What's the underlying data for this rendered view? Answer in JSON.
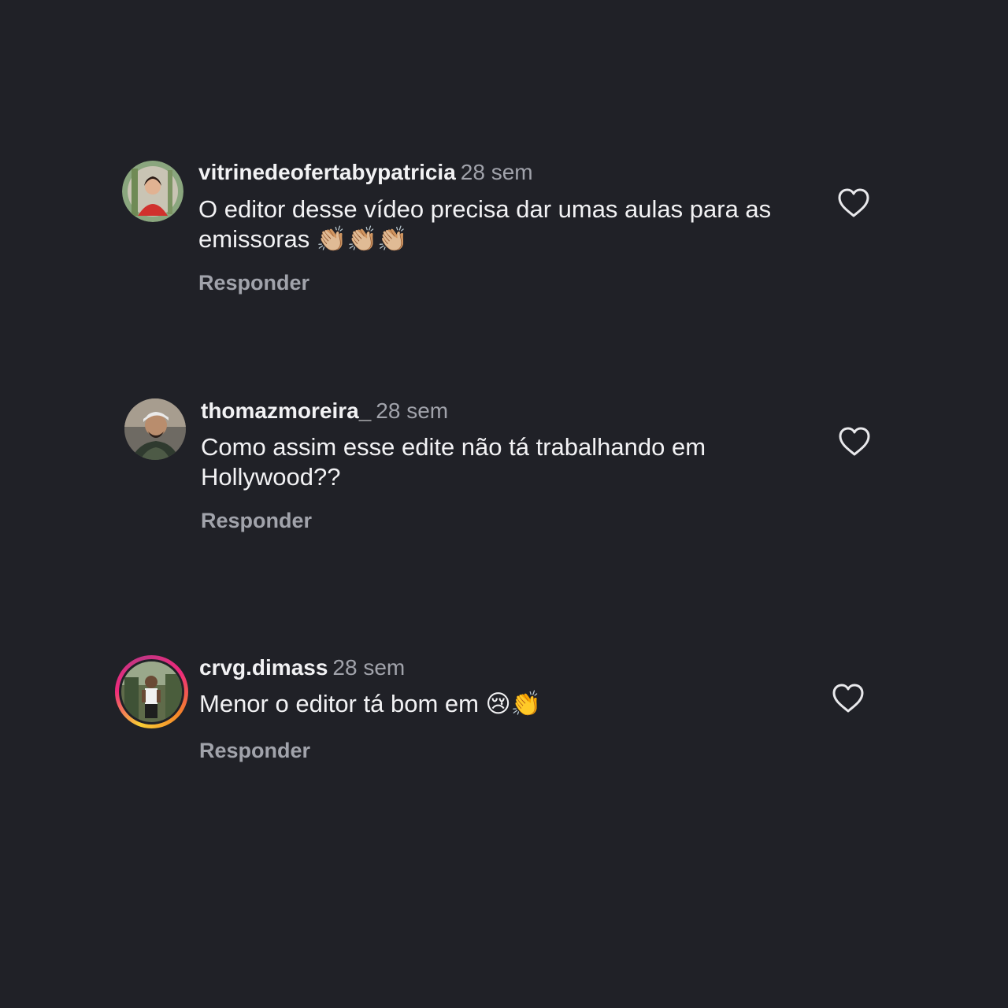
{
  "comments": [
    {
      "username": "vitrinedeofertabypatricia",
      "time": "28 sem",
      "text": "O editor desse vídeo precisa dar umas aulas para as emissoras 👏🏼👏🏼👏🏼",
      "reply_label": "Responder",
      "avatar_icon": "profile-photo-woman-red",
      "has_story_ring": false
    },
    {
      "username": "thomazmoreira_",
      "time": "28 sem",
      "text": "Como assim esse edite não tá trabalhando em Hollywood??",
      "reply_label": "Responder",
      "avatar_icon": "profile-photo-man-cap",
      "has_story_ring": false
    },
    {
      "username": "crvg.dimass",
      "time": "28 sem",
      "text": "Menor o editor tá bom em 😢👏",
      "reply_label": "Responder",
      "avatar_icon": "profile-photo-man-outdoor",
      "has_story_ring": true
    }
  ],
  "like_icon": "heart-outline-icon",
  "colors": {
    "background": "#202127",
    "text_primary": "#f2f2f4",
    "text_secondary": "#a1a3ab",
    "story_ring": [
      "#f9ce34",
      "#ee2a7b",
      "#c13584"
    ]
  }
}
